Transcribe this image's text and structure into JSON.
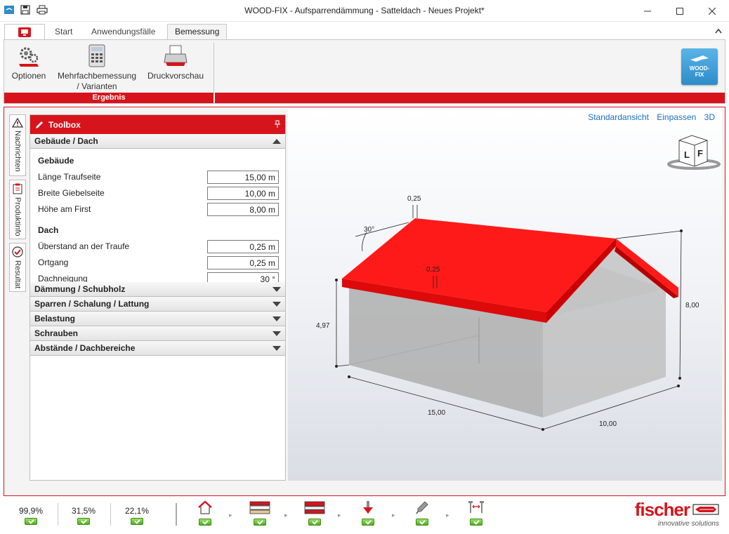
{
  "window": {
    "title": "WOOD-FIX - Aufsparrendämmung - Satteldach - Neues Projekt*"
  },
  "tabs": [
    {
      "label": "Start"
    },
    {
      "label": "Anwendungsfälle"
    },
    {
      "label": "Bemessung",
      "active": true
    }
  ],
  "ribbon": {
    "buttons": [
      {
        "label": "Optionen",
        "icon": "gear-icon"
      },
      {
        "label": "Mehrfachbemessung / Varianten",
        "icon": "calculator-icon"
      },
      {
        "label": "Druckvorschau",
        "icon": "printer-icon"
      }
    ],
    "group_label": "Ergebnis",
    "product_logo": {
      "line1": "WOOD-",
      "line2": "FIX"
    }
  },
  "side_tabs": [
    {
      "label": "Nachrichten",
      "icon": "warning-icon"
    },
    {
      "label": "Produktinfo",
      "icon": "clipboard-icon"
    },
    {
      "label": "Resultat",
      "icon": "check-circle-icon"
    }
  ],
  "toolbox": {
    "title": "Toolbox",
    "open_section": "Gebäude / Dach",
    "groups": {
      "gebaeude": {
        "heading": "Gebäude",
        "fields": [
          {
            "label": "Länge Traufseite",
            "value": "15,00 m"
          },
          {
            "label": "Breite Giebelseite",
            "value": "10,00 m"
          },
          {
            "label": "Höhe am First",
            "value": "8,00 m"
          }
        ]
      },
      "dach": {
        "heading": "Dach",
        "fields": [
          {
            "label": "Überstand an der Traufe",
            "value": "0,25 m"
          },
          {
            "label": "Ortgang",
            "value": "0,25 m"
          },
          {
            "label": "Dachneigung",
            "value": "30 °"
          }
        ]
      }
    },
    "collapsed_sections": [
      "Dämmung / Schubholz",
      "Sparren / Schalung / Lattung",
      "Belastung",
      "Schrauben",
      "Abstände / Dachbereiche"
    ]
  },
  "view": {
    "links": [
      "Standardansicht",
      "Einpassen",
      "3D"
    ],
    "cube_labels": [
      "L",
      "F"
    ],
    "dimensions": {
      "ortgang": "0,25",
      "angle": "30°",
      "overhang": "0,25",
      "eave_height": "4,97",
      "ridge_height": "8,00",
      "length": "15,00",
      "width": "10,00"
    },
    "roof_color": "#ff1a1a"
  },
  "status": {
    "values": [
      "99,9%",
      "31,5%",
      "22,1%"
    ],
    "workflow_icons": [
      "house-icon",
      "layers-icon",
      "roof-layer-icon",
      "load-arrow-icon",
      "screw-icon",
      "spacing-icon"
    ]
  },
  "brand": {
    "name": "fischer",
    "tagline": "innovative solutions"
  },
  "colors": {
    "accent": "#d7141c",
    "link": "#1a6fc1",
    "check": "#4fae1f"
  }
}
